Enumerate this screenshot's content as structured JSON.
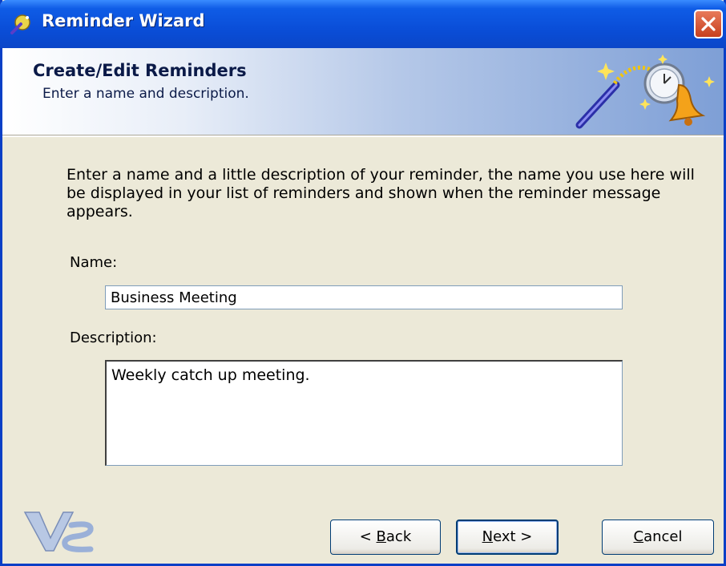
{
  "window": {
    "title": "Reminder Wizard"
  },
  "header": {
    "title": "Create/Edit Reminders",
    "subtitle": "Enter a name and description."
  },
  "body": {
    "intro": "Enter a name and a little description of your reminder, the name you use here will be displayed in your list of reminders and shown when the reminder message appears.",
    "name_label": "Name:",
    "name_value": "Business Meeting",
    "description_label": "Description:",
    "description_value": "Weekly catch up meeting."
  },
  "buttons": {
    "back": {
      "prefix": "< ",
      "accel": "B",
      "rest": "ack"
    },
    "next": {
      "accel": "N",
      "rest": "ext >"
    },
    "cancel": {
      "accel": "C",
      "rest": "ancel"
    }
  },
  "icons": {
    "title": "reminder-wizard-icon",
    "header_art": "magic-wand-bell-icon",
    "logo": "vs-logo-icon",
    "close": "close-icon"
  },
  "colors": {
    "titlebar": "#0A4ED8",
    "window_bg": "#ECE9D8",
    "close_button": "#D9552F"
  }
}
